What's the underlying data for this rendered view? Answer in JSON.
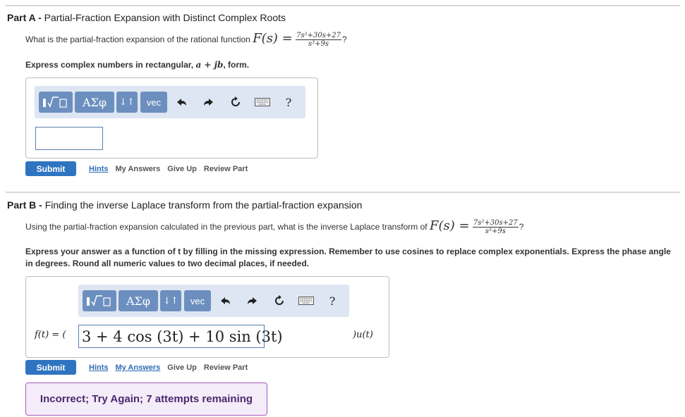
{
  "part_a": {
    "title_prefix": "Part A - ",
    "title": "Partial-Fraction Expansion with Distinct Complex Roots",
    "question": "What is the partial-fraction expansion of the rational function ",
    "func_lhs": "F(s) =",
    "numerator": "7s²+30s+27",
    "denominator": "s³+9s",
    "qmark": "?",
    "instruction_prefix": "Express complex numbers in rectangular, ",
    "instruction_math": "a + jb",
    "instruction_suffix": ", form.",
    "answer_value": "",
    "submit_label": "Submit",
    "links": [
      "Hints",
      "My Answers",
      "Give Up",
      "Review Part"
    ]
  },
  "part_b": {
    "title_prefix": "Part B - ",
    "title": "Finding the inverse Laplace transform from the partial-fraction expansion",
    "question": "Using the partial-fraction expansion calculated in the previous part, what is the inverse Laplace transform of ",
    "func_lhs": "F(s) =",
    "numerator": "7s²+30s+27",
    "denominator": "s³+9s",
    "qmark": "?",
    "instruction": "Express your answer as a function of t by filling in the missing expression. Remember to use cosines to replace complex exponentials. Express the phase angle in degrees. Round all numeric values to two decimal places, if needed.",
    "eq_left": "f(t) = (",
    "answer_value": "3 + 4 cos (3t) + 10 sin (3t)",
    "eq_right": ")u(t)",
    "submit_label": "Submit",
    "links": [
      "Hints",
      "My Answers",
      "Give Up",
      "Review Part"
    ],
    "feedback": "Incorrect; Try Again; 7 attempts remaining"
  },
  "toolbar": {
    "greek_label": "ΑΣφ",
    "arrows_label": "↓↑",
    "vec_label": "vec",
    "help_label": "?",
    "icons": [
      "template-icon",
      "greek-icon",
      "arrows-icon",
      "vec-icon",
      "undo-icon",
      "redo-icon",
      "reset-icon",
      "keyboard-icon",
      "help-icon"
    ]
  },
  "colors": {
    "button_blue": "#6c8fbf",
    "toolbar_bg": "#dde6f2",
    "submit_blue": "#2f74c0",
    "link_blue": "#2f6db5",
    "feedback_border": "#a35ab8",
    "feedback_bg": "#f5ecf9"
  }
}
